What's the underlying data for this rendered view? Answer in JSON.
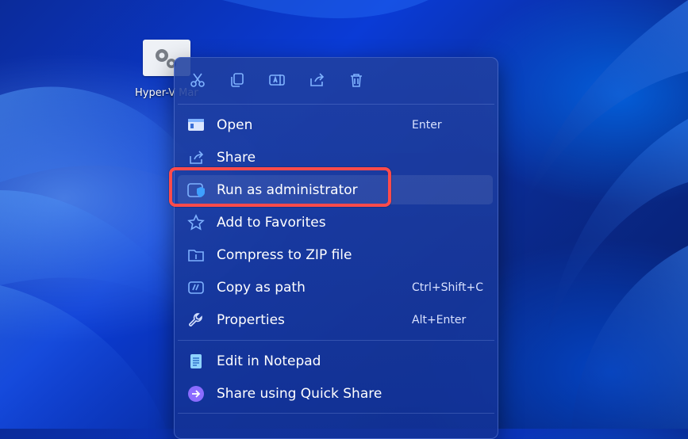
{
  "desktop": {
    "icon_label": "Hyper-V Manager"
  },
  "context_menu": {
    "quick_actions": [
      {
        "name": "cut",
        "icon": "scissors-icon"
      },
      {
        "name": "copy",
        "icon": "copy-icon"
      },
      {
        "name": "rename",
        "icon": "rename-icon"
      },
      {
        "name": "share",
        "icon": "share-icon"
      },
      {
        "name": "delete",
        "icon": "trash-icon"
      }
    ],
    "items": [
      {
        "label": "Open",
        "shortcut": "Enter",
        "icon": "open-window-icon"
      },
      {
        "label": "Share",
        "shortcut": "",
        "icon": "share-icon"
      },
      {
        "label": "Run as administrator",
        "shortcut": "",
        "icon": "shield-window-icon"
      },
      {
        "label": "Add to Favorites",
        "shortcut": "",
        "icon": "star-icon"
      },
      {
        "label": "Compress to ZIP file",
        "shortcut": "",
        "icon": "zip-folder-icon"
      },
      {
        "label": "Copy as path",
        "shortcut": "Ctrl+Shift+C",
        "icon": "path-icon"
      },
      {
        "label": "Properties",
        "shortcut": "Alt+Enter",
        "icon": "wrench-icon"
      },
      {
        "label": "Edit in Notepad",
        "shortcut": "",
        "icon": "notepad-icon"
      },
      {
        "label": "Share using Quick Share",
        "shortcut": "",
        "icon": "quick-share-icon"
      }
    ]
  },
  "colors": {
    "accent": "#ff4b4b",
    "menu_bg": "#1f3ea0",
    "icon_blue": "#7fb2ff"
  }
}
